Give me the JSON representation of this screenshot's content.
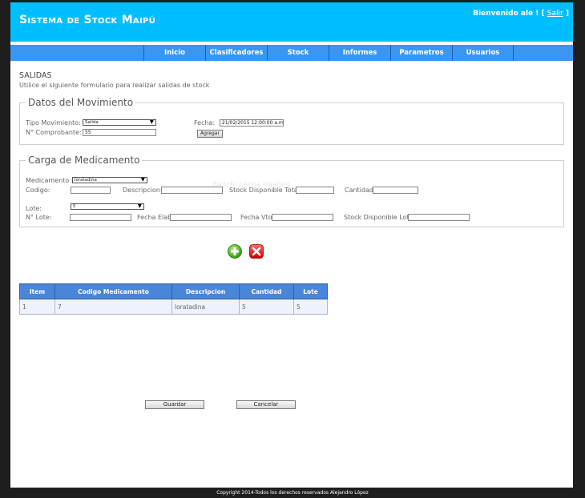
{
  "header": {
    "title": "Sistema de Stock Maipú",
    "welcome_prefix": "Bienvenido ale ! [",
    "logout_label": "Salir",
    "welcome_suffix": "]"
  },
  "nav": {
    "items": [
      "Inicio",
      "Clasificadores",
      "Stock",
      "Informes",
      "Parametros",
      "Usuarios"
    ]
  },
  "page": {
    "title": "SALIDAS",
    "subtitle": "Utilice el siguiente formulario para realizar salidas de stock"
  },
  "movimiento": {
    "legend": "Datos del Movimiento",
    "tipo_label": "Tipo Movimiento:",
    "tipo_value": "Salida",
    "fecha_label": "Fecha:",
    "fecha_value": "21/02/2015 12:00:00 a.m.",
    "comprobante_label": "N° Comprobante:",
    "comprobante_value": "55",
    "agregar_label": "Agregar"
  },
  "carga": {
    "legend": "Carga de Medicamento",
    "medicamento_label": "Medicamento :",
    "medicamento_value": "loratadina",
    "watermark": "Ranchi Leona Imagen",
    "codigo_label": "Codigo:",
    "descripcion_label": "Descripcion:",
    "stock_total_label": "Stock Disponible Total:",
    "cantidad_label": "Cantidad:",
    "lote_label": "Lote:",
    "lote_value": "5",
    "nlote_label": "N° Lote:",
    "fecha_elab_label": "Fecha Elab:",
    "fecha_vto_label": "Fecha Vto:",
    "stock_lote_label": "Stock Disponible Lote:"
  },
  "table": {
    "headers": [
      "Item",
      "Codigo Medicamento",
      "Descripcion",
      "Cantidad",
      "Lote"
    ],
    "rows": [
      [
        "1",
        "7",
        "loratadina",
        "5",
        "5"
      ]
    ]
  },
  "actions": {
    "guardar_label": "Guardar",
    "cancelar_label": "Cancelar"
  },
  "footer": {
    "text": "Copyright 2014-Todos los derechos reservados Alejandro López"
  },
  "colors": {
    "header_bg": "#00bfff",
    "nav_bg": "#3a96f0",
    "table_header_bg": "#4a86d8"
  }
}
